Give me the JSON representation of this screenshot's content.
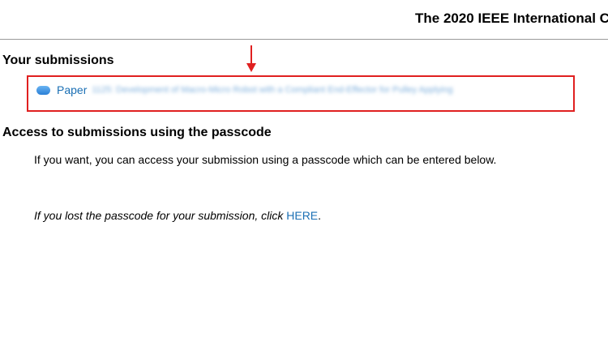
{
  "header": {
    "conference_title": "The 2020 IEEE International C"
  },
  "submissions": {
    "heading": "Your submissions",
    "paper_label": "Paper",
    "paper_title_redacted": "1125: Development of Macro-Micro Robot with a Compliant End-Effector for Pulley Applying"
  },
  "passcode_access": {
    "heading": "Access to submissions using the passcode",
    "info_text": "If you want, you can access your submission using a passcode which can be entered below.",
    "lost_text": "If you lost the passcode for your submission, click ",
    "lost_link": "HERE",
    "lost_suffix": "."
  },
  "colors": {
    "link": "#1a6fb4",
    "annotation": "#e02020"
  },
  "icons": {
    "paper_icon": "blue-pill-bullet-icon",
    "annotation_arrow": "down-arrow-icon"
  }
}
